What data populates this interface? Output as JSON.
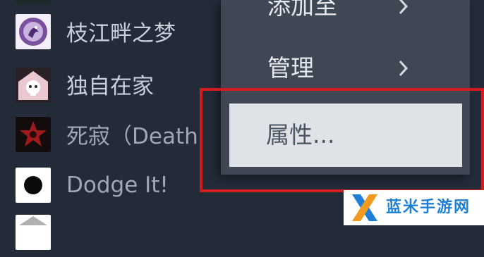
{
  "game_list": {
    "items": [
      {
        "label": "枝江畔之梦",
        "icon": "dream-girl-icon"
      },
      {
        "label": "独自在家",
        "icon": "ghost-house-icon"
      },
      {
        "label": "死寂（Death",
        "icon": "red-star-icon"
      },
      {
        "label": "Dodge It!",
        "icon": "black-dot-icon"
      }
    ]
  },
  "context_menu": {
    "items": [
      {
        "label": "添加至",
        "has_submenu": true
      },
      {
        "label": "管理",
        "has_submenu": true
      },
      {
        "label": "属性...",
        "highlighted": true
      }
    ]
  },
  "watermark": {
    "text": "蓝米手游网",
    "logo": "x-logo-icon"
  },
  "colors": {
    "background": "#232a38",
    "menu_bg": "#3f4654",
    "highlight_bg": "#dfe2e6",
    "annotation_red": "#d11d1d",
    "watermark_blue": "#1e7fd6"
  }
}
